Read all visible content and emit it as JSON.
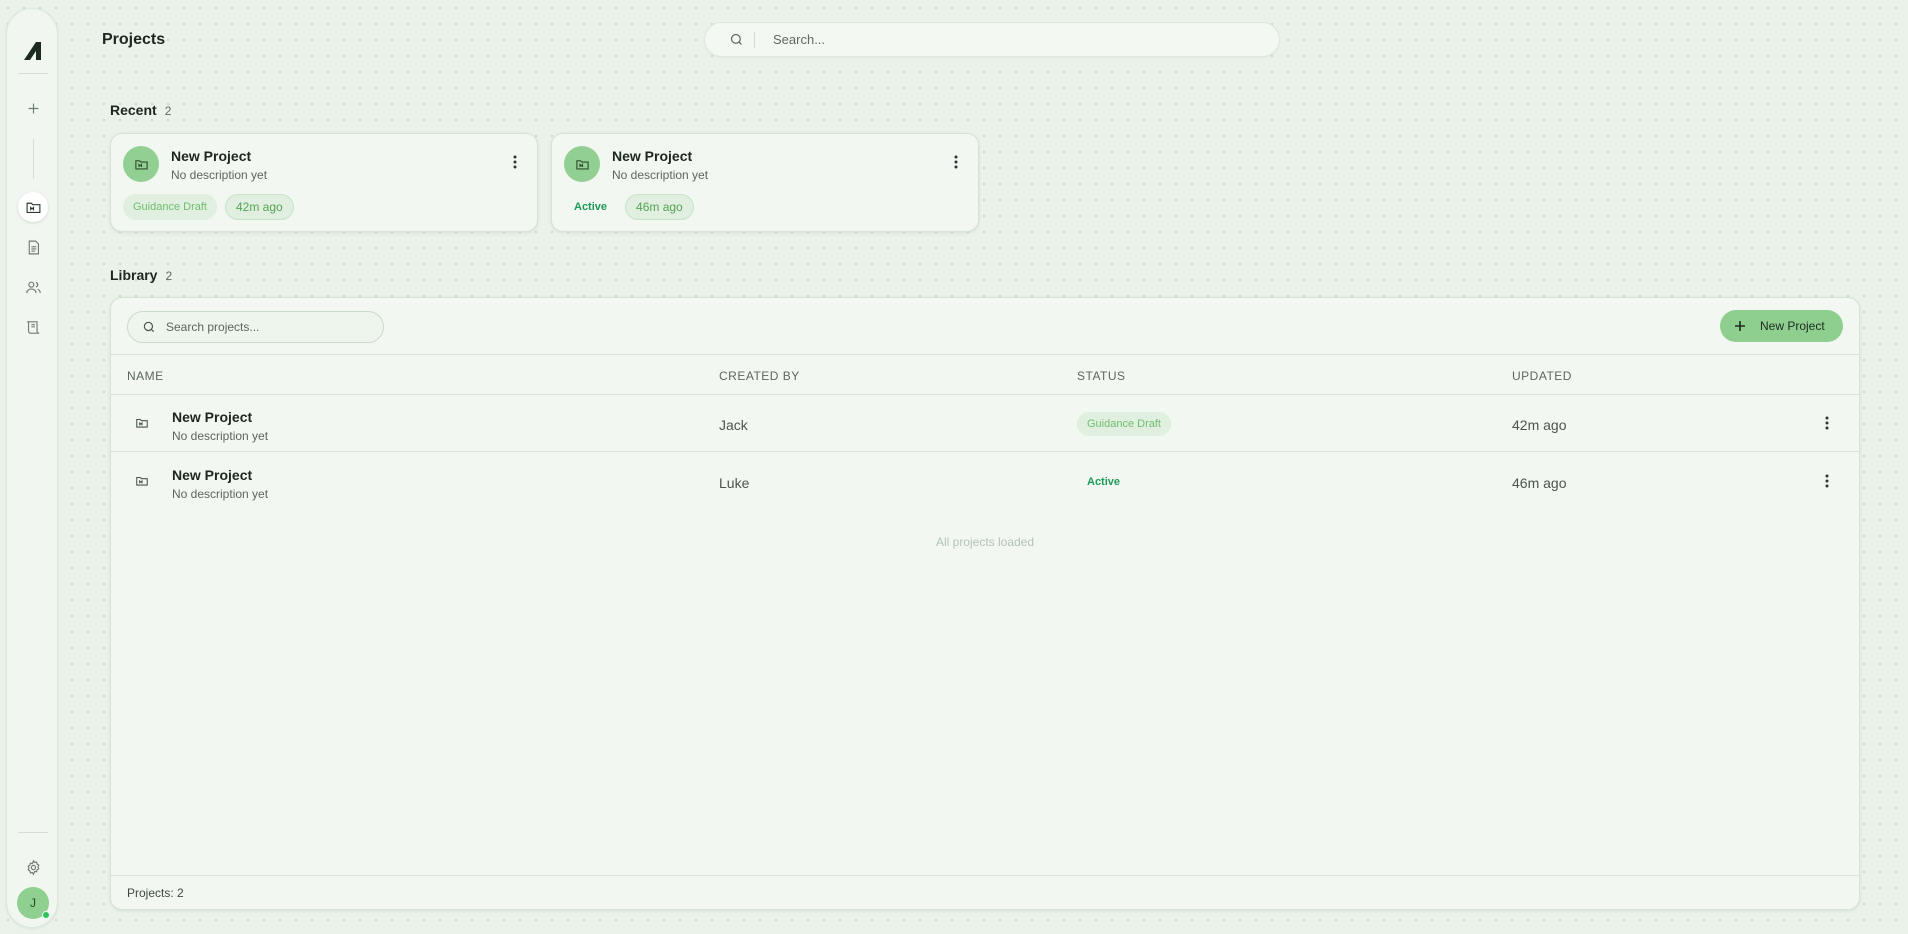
{
  "app": {
    "page_title": "Projects"
  },
  "search": {
    "placeholder": "Search..."
  },
  "sidebar": {
    "items": [
      {
        "name": "logo",
        "icon": "logo-icon"
      },
      {
        "name": "new",
        "icon": "plus-icon"
      },
      {
        "name": "projects",
        "icon": "folder-icon",
        "active": true
      },
      {
        "name": "documents",
        "icon": "document-icon"
      },
      {
        "name": "team",
        "icon": "users-icon"
      },
      {
        "name": "scroll",
        "icon": "scroll-icon"
      },
      {
        "name": "settings",
        "icon": "gear-icon"
      }
    ],
    "avatar_initial": "J"
  },
  "recent": {
    "heading": "Recent",
    "count": "2",
    "cards": [
      {
        "title": "New Project",
        "description": "No description yet",
        "status": "Guidance Draft",
        "time": "42m ago"
      },
      {
        "title": "New Project",
        "description": "No description yet",
        "status": "Active",
        "time": "46m ago"
      }
    ]
  },
  "library": {
    "heading": "Library",
    "count": "2",
    "search_placeholder": "Search projects...",
    "new_button_label": "New Project",
    "columns": [
      "NAME",
      "CREATED BY",
      "STATUS",
      "UPDATED"
    ],
    "rows": [
      {
        "name": "New Project",
        "description": "No description yet",
        "created_by": "Jack",
        "status": "Guidance Draft",
        "updated": "42m ago"
      },
      {
        "name": "New Project",
        "description": "No description yet",
        "created_by": "Luke",
        "status": "Active",
        "updated": "46m ago"
      }
    ],
    "end_message": "All projects loaded",
    "footer": "Projects: 2"
  },
  "colors": {
    "accent": "#8ece8e",
    "background": "#ebf2ea",
    "status_active": "#1d9a5a",
    "status_draft": "#6fbf6f",
    "online": "#2ec25b"
  }
}
